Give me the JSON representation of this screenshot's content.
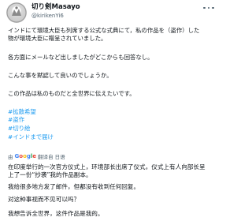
{
  "post": {
    "display_name": "切り剣Masayo",
    "handle": "@kirikenYi6",
    "original": {
      "line1": "インドにて環境大臣も列席する公式な式典にて，私の作品を（盗作）した",
      "line2": "物が環境大臣に贈呈されていました。",
      "line3": "各方面にメールなど出しましたがどこからも回答なし。",
      "line4": "こんな事を黙認して良いのでしょうか。",
      "line5": "この作品は私のものだと全世界に伝えたいです。"
    },
    "hashtags": [
      "#拡散希望",
      "#盗作",
      "#切り絵",
      "#インドまで届け"
    ],
    "translation_bar": {
      "prefix": "由",
      "brand_letters": [
        "G",
        "o",
        "o",
        "g",
        "l",
        "e"
      ],
      "suffix": "翻译自 日语"
    },
    "translation": {
      "line1": "在印度举行的一次官方仪式上，环境部长出席了仪式，仪式上有人向部长呈",
      "line2": "上了一份“抄袭”我的作品副本。",
      "line3": "我给很多地方发了邮件，但都没有收到任何回复。",
      "line4": "对这种事视而不见可以吗？",
      "line5": "我想告诉全世界，这件作品是我的。"
    }
  }
}
